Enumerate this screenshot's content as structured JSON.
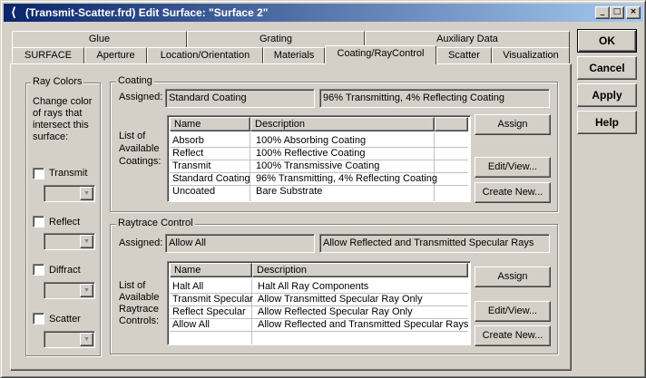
{
  "window": {
    "title": "(Transmit-Scatter.frd) Edit Surface: \"Surface 2\"",
    "app_icon": "app-icon",
    "minimize": "_",
    "maximize": "□",
    "close": "×"
  },
  "tabs_row_back": [
    {
      "label": "Glue"
    },
    {
      "label": "Grating"
    },
    {
      "label": "Auxiliary Data"
    }
  ],
  "tabs_row_front": [
    {
      "label": "SURFACE"
    },
    {
      "label": "Aperture"
    },
    {
      "label": "Location/Orientation"
    },
    {
      "label": "Materials"
    },
    {
      "label": "Coating/RayControl",
      "active": true
    },
    {
      "label": "Scatter"
    },
    {
      "label": "Visualization"
    }
  ],
  "side_buttons": {
    "ok": "OK",
    "cancel": "Cancel",
    "apply": "Apply",
    "help": "Help"
  },
  "ray_colors": {
    "title": "Ray Colors",
    "description": [
      "Change color",
      "of rays that",
      "intersect this",
      "surface:"
    ],
    "items": [
      {
        "label": "Transmit",
        "checked": false
      },
      {
        "label": "Reflect",
        "checked": false
      },
      {
        "label": "Diffract",
        "checked": false
      },
      {
        "label": "Scatter",
        "checked": false
      }
    ]
  },
  "coating": {
    "title": "Coating",
    "assigned_label": "Assigned:",
    "assigned_value": "Standard Coating",
    "assigned_description": "96% Transmitting, 4% Reflecting Coating",
    "list_label": [
      "List of",
      "Available",
      "Coatings:"
    ],
    "columns": [
      "Name",
      "Description"
    ],
    "rows": [
      [
        "Absorb",
        "100% Absorbing Coating"
      ],
      [
        "Reflect",
        "100% Reflective Coating"
      ],
      [
        "Transmit",
        "100% Transmissive Coating"
      ],
      [
        "Standard Coating",
        "96% Transmitting, 4% Reflecting Coating"
      ],
      [
        "Uncoated",
        "Bare Substrate"
      ]
    ],
    "buttons": {
      "assign": "Assign",
      "edit": "Edit/View...",
      "create": "Create New..."
    }
  },
  "raytrace": {
    "title": "Raytrace Control",
    "assigned_label": "Assigned:",
    "assigned_value": "Allow All",
    "assigned_description": "Allow Reflected and Transmitted Specular Rays",
    "list_label": [
      "List of",
      "Available",
      "Raytrace",
      "Controls:"
    ],
    "columns": [
      "Name",
      "Description"
    ],
    "rows": [
      [
        "Halt All",
        "Halt All Ray Components"
      ],
      [
        "Transmit Specular",
        "Allow Transmitted Specular Ray Only"
      ],
      [
        "Reflect Specular",
        "Allow Reflected Specular Ray Only"
      ],
      [
        "Allow All",
        "Allow Reflected and Transmitted Specular Rays"
      ]
    ],
    "buttons": {
      "assign": "Assign",
      "edit": "Edit/View...",
      "create": "Create New..."
    }
  }
}
